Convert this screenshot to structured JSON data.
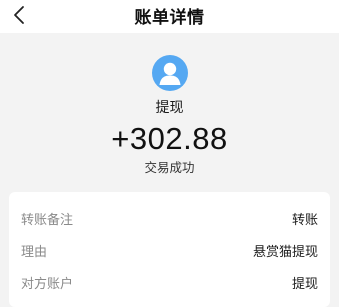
{
  "nav": {
    "title": "账单详情",
    "back_icon": "chevron-left-icon"
  },
  "header": {
    "avatar_icon": "user-icon",
    "avatar_color": "#55a8f2",
    "type": "提现",
    "amount": "+302.88",
    "status": "交易成功"
  },
  "details": [
    {
      "label": "转账备注",
      "value": "转账"
    },
    {
      "label": "理由",
      "value": "悬赏猫提现"
    },
    {
      "label": "对方账户",
      "value": "提现"
    }
  ]
}
